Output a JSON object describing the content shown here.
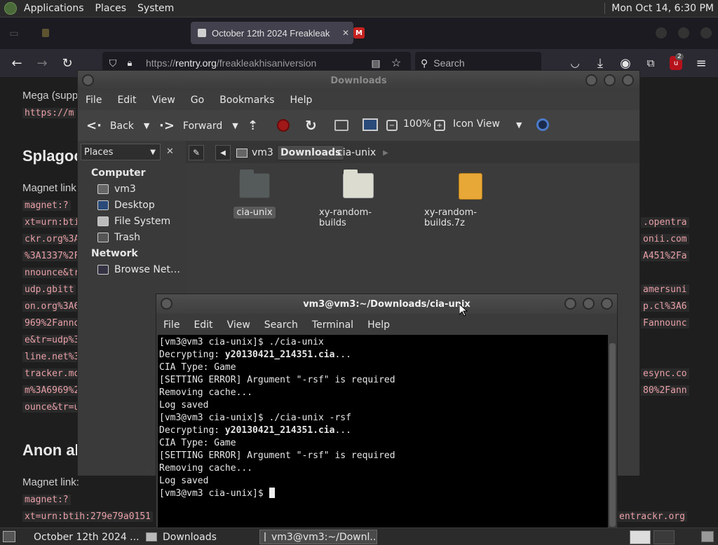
{
  "top_panel": {
    "menus": [
      "Applications",
      "Places",
      "System"
    ],
    "clock": "Mon Oct 14,  6:30 PM"
  },
  "browser": {
    "active_tab": "October 12th 2024 Freakleak",
    "url_prefix": "https://",
    "url_host": "rentry.org",
    "url_path": "/freakleakhisaniversion",
    "search_placeholder": "Search",
    "badge_count": "2"
  },
  "page": {
    "mega_label": "Mega (supp",
    "mega_code": "https://m",
    "splag_heading": "Splagoo",
    "magnet_label_1": "Magnet link",
    "magnet_code_left": [
      "magnet:?",
      "xt=urn:bti",
      "ckr.org%3A",
      "%3A1337%2F",
      "nnounce&tr",
      "udp.gbitt",
      "on.org%3A6",
      "969%2Fanno",
      "e&tr=udp%3",
      "line.net%3",
      "tracker.mo",
      "m%3A6969%2",
      "ounce&tr=u"
    ],
    "magnet_code_right": [
      ".opentra",
      "onii.com",
      "A451%2Fa",
      "amersuni",
      "p.cl%3A6",
      "Fannounc",
      "esync.co",
      "80%2Fann"
    ],
    "anon_heading": "Anon al",
    "magnet_label_2": "Magnet link:",
    "magnet_code_2": "magnet:?",
    "magnet_code_3": "xt=urn:btih:279e79a0151",
    "magnet_code_3_right": "entrackr.org"
  },
  "file_manager": {
    "title": "Downloads",
    "menus": [
      "File",
      "Edit",
      "View",
      "Go",
      "Bookmarks",
      "Help"
    ],
    "toolbar": {
      "back": "Back",
      "forward": "Forward",
      "zoom": "100%",
      "view_mode": "Icon View"
    },
    "places_label": "Places",
    "sidebar": {
      "computer_header": "Computer",
      "computer_items": [
        "vm3",
        "Desktop",
        "File System",
        "Trash"
      ],
      "network_header": "Network",
      "network_items": [
        "Browse Net…"
      ]
    },
    "path": [
      "vm3",
      "Downloads",
      "cia-unix"
    ],
    "files": [
      {
        "name": "cia-unix",
        "kind": "folder-dark",
        "selected": true
      },
      {
        "name": "xy-random-builds",
        "kind": "folder-light",
        "selected": false
      },
      {
        "name": "xy-random-builds.7z",
        "kind": "archive",
        "selected": false
      }
    ]
  },
  "terminal": {
    "title": "vm3@vm3:~/Downloads/cia-unix",
    "menus": [
      "File",
      "Edit",
      "View",
      "Search",
      "Terminal",
      "Help"
    ],
    "lines": [
      {
        "text": "[vm3@vm3 cia-unix]$ ./cia-unix",
        "bold": ""
      },
      {
        "text": "Decrypting: ",
        "bold": "y20130421_214351.cia",
        "after": "..."
      },
      {
        "text": "CIA Type: Game",
        "bold": ""
      },
      {
        "text": "[SETTING ERROR] Argument \"-rsf\" is required",
        "bold": ""
      },
      {
        "text": "Removing cache...",
        "bold": ""
      },
      {
        "text": "Log saved",
        "bold": ""
      },
      {
        "text": "[vm3@vm3 cia-unix]$ ./cia-unix -rsf",
        "bold": ""
      },
      {
        "text": "Decrypting: ",
        "bold": "y20130421_214351.cia",
        "after": "..."
      },
      {
        "text": "CIA Type: Game",
        "bold": ""
      },
      {
        "text": "[SETTING ERROR] Argument \"-rsf\" is required",
        "bold": ""
      },
      {
        "text": "Removing cache...",
        "bold": ""
      },
      {
        "text": "Log saved",
        "bold": ""
      }
    ],
    "prompt": "[vm3@vm3 cia-unix]$ "
  },
  "taskbar": {
    "items": [
      "October 12th 2024 ...",
      "Downloads",
      "vm3@vm3:~/Downl..."
    ]
  },
  "colors": {
    "panel": "#2b2b2b",
    "accent_selected": "#5a5a5a",
    "code_text": "#e8a0a8",
    "folder_light": "#dcdcd0",
    "archive": "#e8a838"
  }
}
